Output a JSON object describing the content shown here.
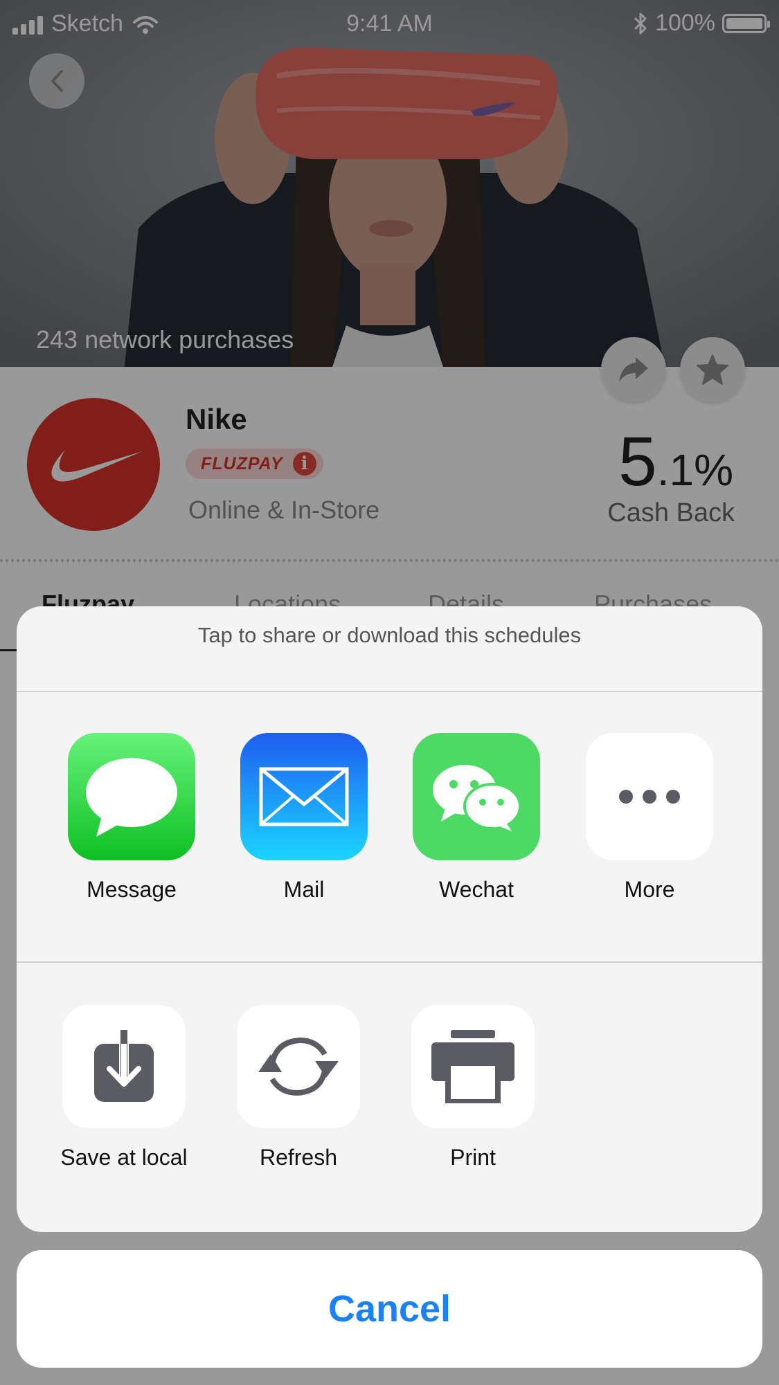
{
  "status_bar": {
    "carrier": "Sketch",
    "time": "9:41 AM",
    "battery": "100%"
  },
  "hero": {
    "purchases": "243 network purchases"
  },
  "merchant": {
    "name": "Nike",
    "badge": "FLUZPAY",
    "badge_info": "i",
    "type": "Online & In-Store",
    "cashback_whole": "5",
    "cashback_fraction": ".1%",
    "cashback_label": "Cash Back"
  },
  "tabs": [
    {
      "label": "Fluzpay"
    },
    {
      "label": "Locations"
    },
    {
      "label": "Details"
    },
    {
      "label": "Purchases"
    }
  ],
  "share_sheet": {
    "title": "Tap to share or download this schedules",
    "apps": [
      {
        "label": "Message",
        "icon": "message-icon",
        "color": "#24c436"
      },
      {
        "label": "Mail",
        "icon": "mail-icon",
        "color": "#1e8ff5"
      },
      {
        "label": "Wechat",
        "icon": "wechat-icon",
        "color": "#4cd964"
      },
      {
        "label": "More",
        "icon": "more-icon",
        "color": "#ffffff"
      }
    ],
    "actions": [
      {
        "label": "Save at local",
        "icon": "download-icon"
      },
      {
        "label": "Refresh",
        "icon": "refresh-icon"
      },
      {
        "label": "Print",
        "icon": "print-icon"
      }
    ],
    "cancel_label": "Cancel"
  },
  "colors": {
    "accent": "#1a82f7",
    "brand": "#d7322b"
  }
}
